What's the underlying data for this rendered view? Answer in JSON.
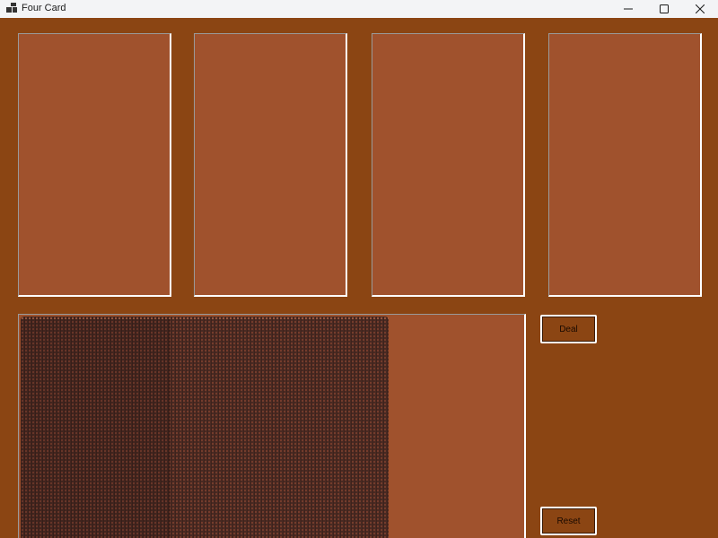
{
  "window": {
    "title": "Four Card",
    "app_icon": "app-window-icon",
    "controls": [
      "minimize-icon",
      "maximize-icon",
      "close-icon"
    ]
  },
  "colors": {
    "form_background": "#8b4513",
    "card_slot_background": "#a0522d",
    "deck_back_pattern": "#4a2a22"
  },
  "card_slots": [
    {
      "id": "card-slot-1"
    },
    {
      "id": "card-slot-2"
    },
    {
      "id": "card-slot-3"
    },
    {
      "id": "card-slot-4"
    }
  ],
  "buttons": {
    "deal_label": "Deal",
    "reset_label": "Reset"
  }
}
